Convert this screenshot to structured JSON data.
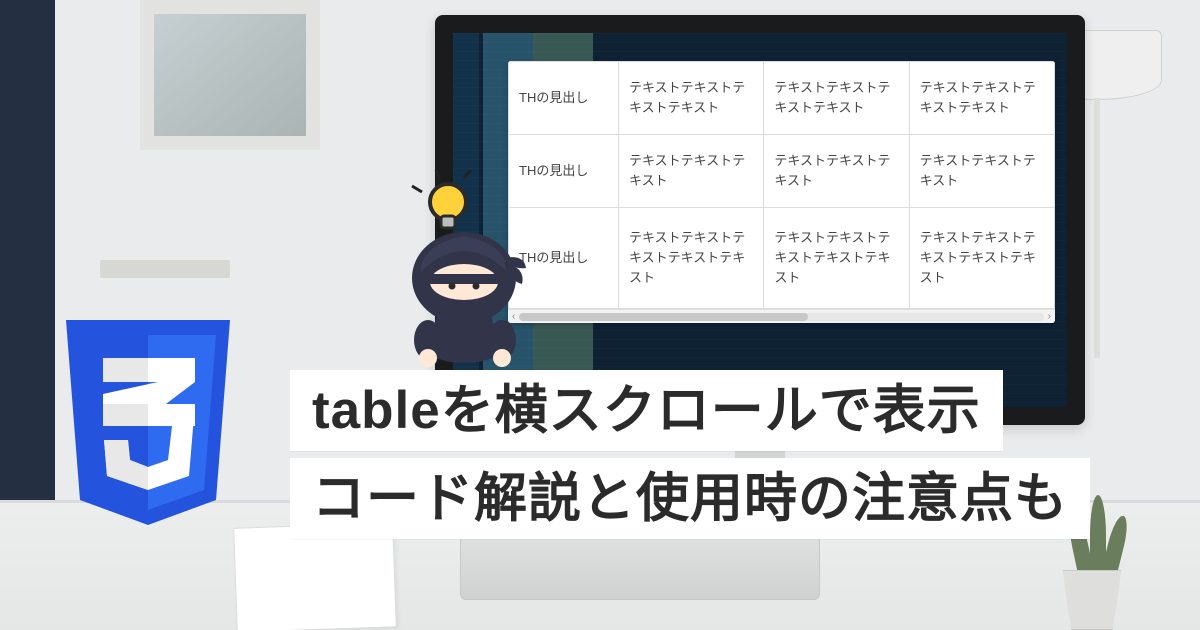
{
  "colors": {
    "band": "#243041",
    "shield": "#2453dd",
    "shield_inner": "#2962e8"
  },
  "logo": {
    "text": "3",
    "alt": "CSS3"
  },
  "headline": {
    "line1": "tableを横スクロールで表示",
    "line2": "コード解説と使用時の注意点も"
  },
  "table": {
    "header_label": "THの見出し",
    "rows": [
      {
        "th": "THの見出し",
        "cells": [
          "テキストテキストテキストテキスト",
          "テキストテキストテキストテキスト",
          "テキストテキストテキストテキスト"
        ]
      },
      {
        "th": "THの見出し",
        "cells": [
          "テキストテキストテキスト",
          "テキストテキストテキスト",
          "テキストテキストテキスト"
        ]
      },
      {
        "th": "THの見出し",
        "cells": [
          "テキストテキストテキストテキストテキスト",
          "テキストテキストテキストテキストテキスト",
          "テキストテキストテキストテキストテキスト"
        ]
      }
    ]
  },
  "scrollbar": {
    "left_arrow": "‹",
    "right_arrow": "›"
  }
}
